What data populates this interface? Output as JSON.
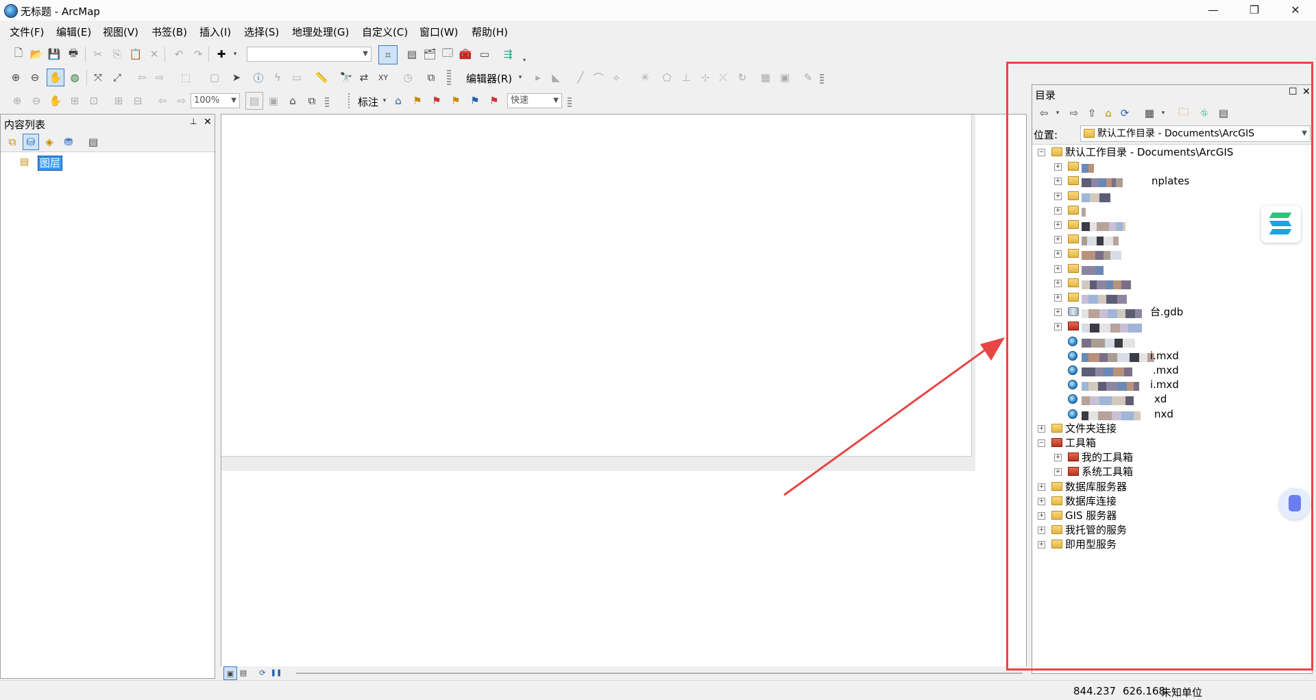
{
  "window": {
    "title": "无标题 - ArcMap",
    "minimize": "—",
    "restore": "❐",
    "close": "✕"
  },
  "menu": [
    "文件(F)",
    "编辑(E)",
    "视图(V)",
    "书签(B)",
    "插入(I)",
    "选择(S)",
    "地理处理(G)",
    "自定义(C)",
    "窗口(W)",
    "帮助(H)"
  ],
  "toolbar": {
    "scale_value": "",
    "zoom_value": "100%",
    "editor_label": "编辑器(R)",
    "label_tool": "标注",
    "quick_value": "快速"
  },
  "toc": {
    "title": "内容列表",
    "pin": "📌",
    "close": "✕",
    "root_layer": "图层"
  },
  "catalog": {
    "title": "目录",
    "location_label": "位置:",
    "location_value": "默认工作目录 - Documents\\ArcGIS",
    "root": "默认工作目录 - Documents\\ArcGIS",
    "items_visible_text": [
      "nplates",
      "台.gdb",
      "i.mxd",
      ".mxd",
      "i.mxd",
      "xd",
      "nxd"
    ],
    "nodes": [
      "文件夹连接",
      "工具箱",
      "我的工具箱",
      "系统工具箱",
      "数据库服务器",
      "数据库连接",
      "GIS 服务器",
      "我托管的服务",
      "即用型服务"
    ]
  },
  "status": {
    "x": "844.237",
    "y": "626.168",
    "units": "未知单位"
  },
  "colors": {
    "annotation_red": "#e84545",
    "selection_blue": "#3399ff"
  }
}
